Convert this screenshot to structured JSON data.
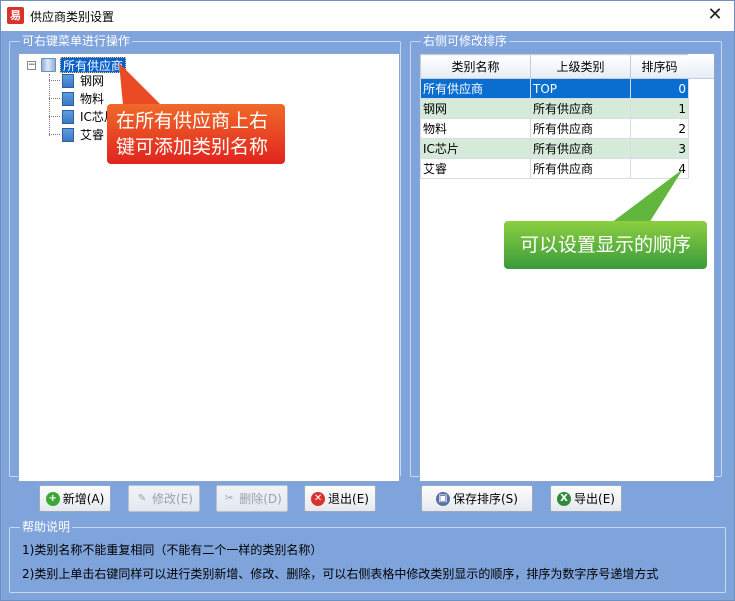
{
  "window": {
    "title": "供应商类别设置",
    "app_icon_text": "易",
    "close_glyph": "✕"
  },
  "left_group": {
    "caption": "可右键菜单进行操作",
    "tree": {
      "expander": "−",
      "root": "所有供应商",
      "children": [
        "钢网",
        "物料",
        "IC芯片",
        "艾睿"
      ]
    }
  },
  "right_group": {
    "caption": "右侧可修改排序",
    "grid": {
      "columns": [
        "类别名称",
        "上级类别",
        "排序码"
      ],
      "rows": [
        {
          "name": "所有供应商",
          "parent": "TOP",
          "order": "0"
        },
        {
          "name": "钢网",
          "parent": "所有供应商",
          "order": "1"
        },
        {
          "name": "物料",
          "parent": "所有供应商",
          "order": "2"
        },
        {
          "name": "IC芯片",
          "parent": "所有供应商",
          "order": "3"
        },
        {
          "name": "艾睿",
          "parent": "所有供应商",
          "order": "4"
        }
      ],
      "selected_row": 0
    }
  },
  "buttons": {
    "add": "新增(A)",
    "edit": "修改(E)",
    "delete": "删除(D)",
    "exit": "退出(E)",
    "save_order": "保存排序(S)",
    "export": "导出(E)"
  },
  "icons": {
    "add": "+",
    "edit": "✎",
    "delete": "✂",
    "exit": "✕",
    "save_order": "▣",
    "export": "X"
  },
  "help": {
    "caption": "帮助说明",
    "line1": "1)类别名称不能重复相同（不能有二个一样的类别名称）",
    "line2": "2)类别上单击右键同样可以进行类别新增、修改、删除，可以右侧表格中修改类别显示的顺序，排序为数字序号递增方式"
  },
  "annotations": {
    "red_callout": [
      "在所有供应商上右",
      "键可添加类别名称"
    ],
    "green_callout": "可以设置显示的顺序"
  },
  "colors": {
    "window_bg": "#7fa3db",
    "selection": "#0a6ed1",
    "alt_row": "#d6ead9",
    "callout_red": "#e0241e",
    "callout_green": "#3a9b3c"
  }
}
